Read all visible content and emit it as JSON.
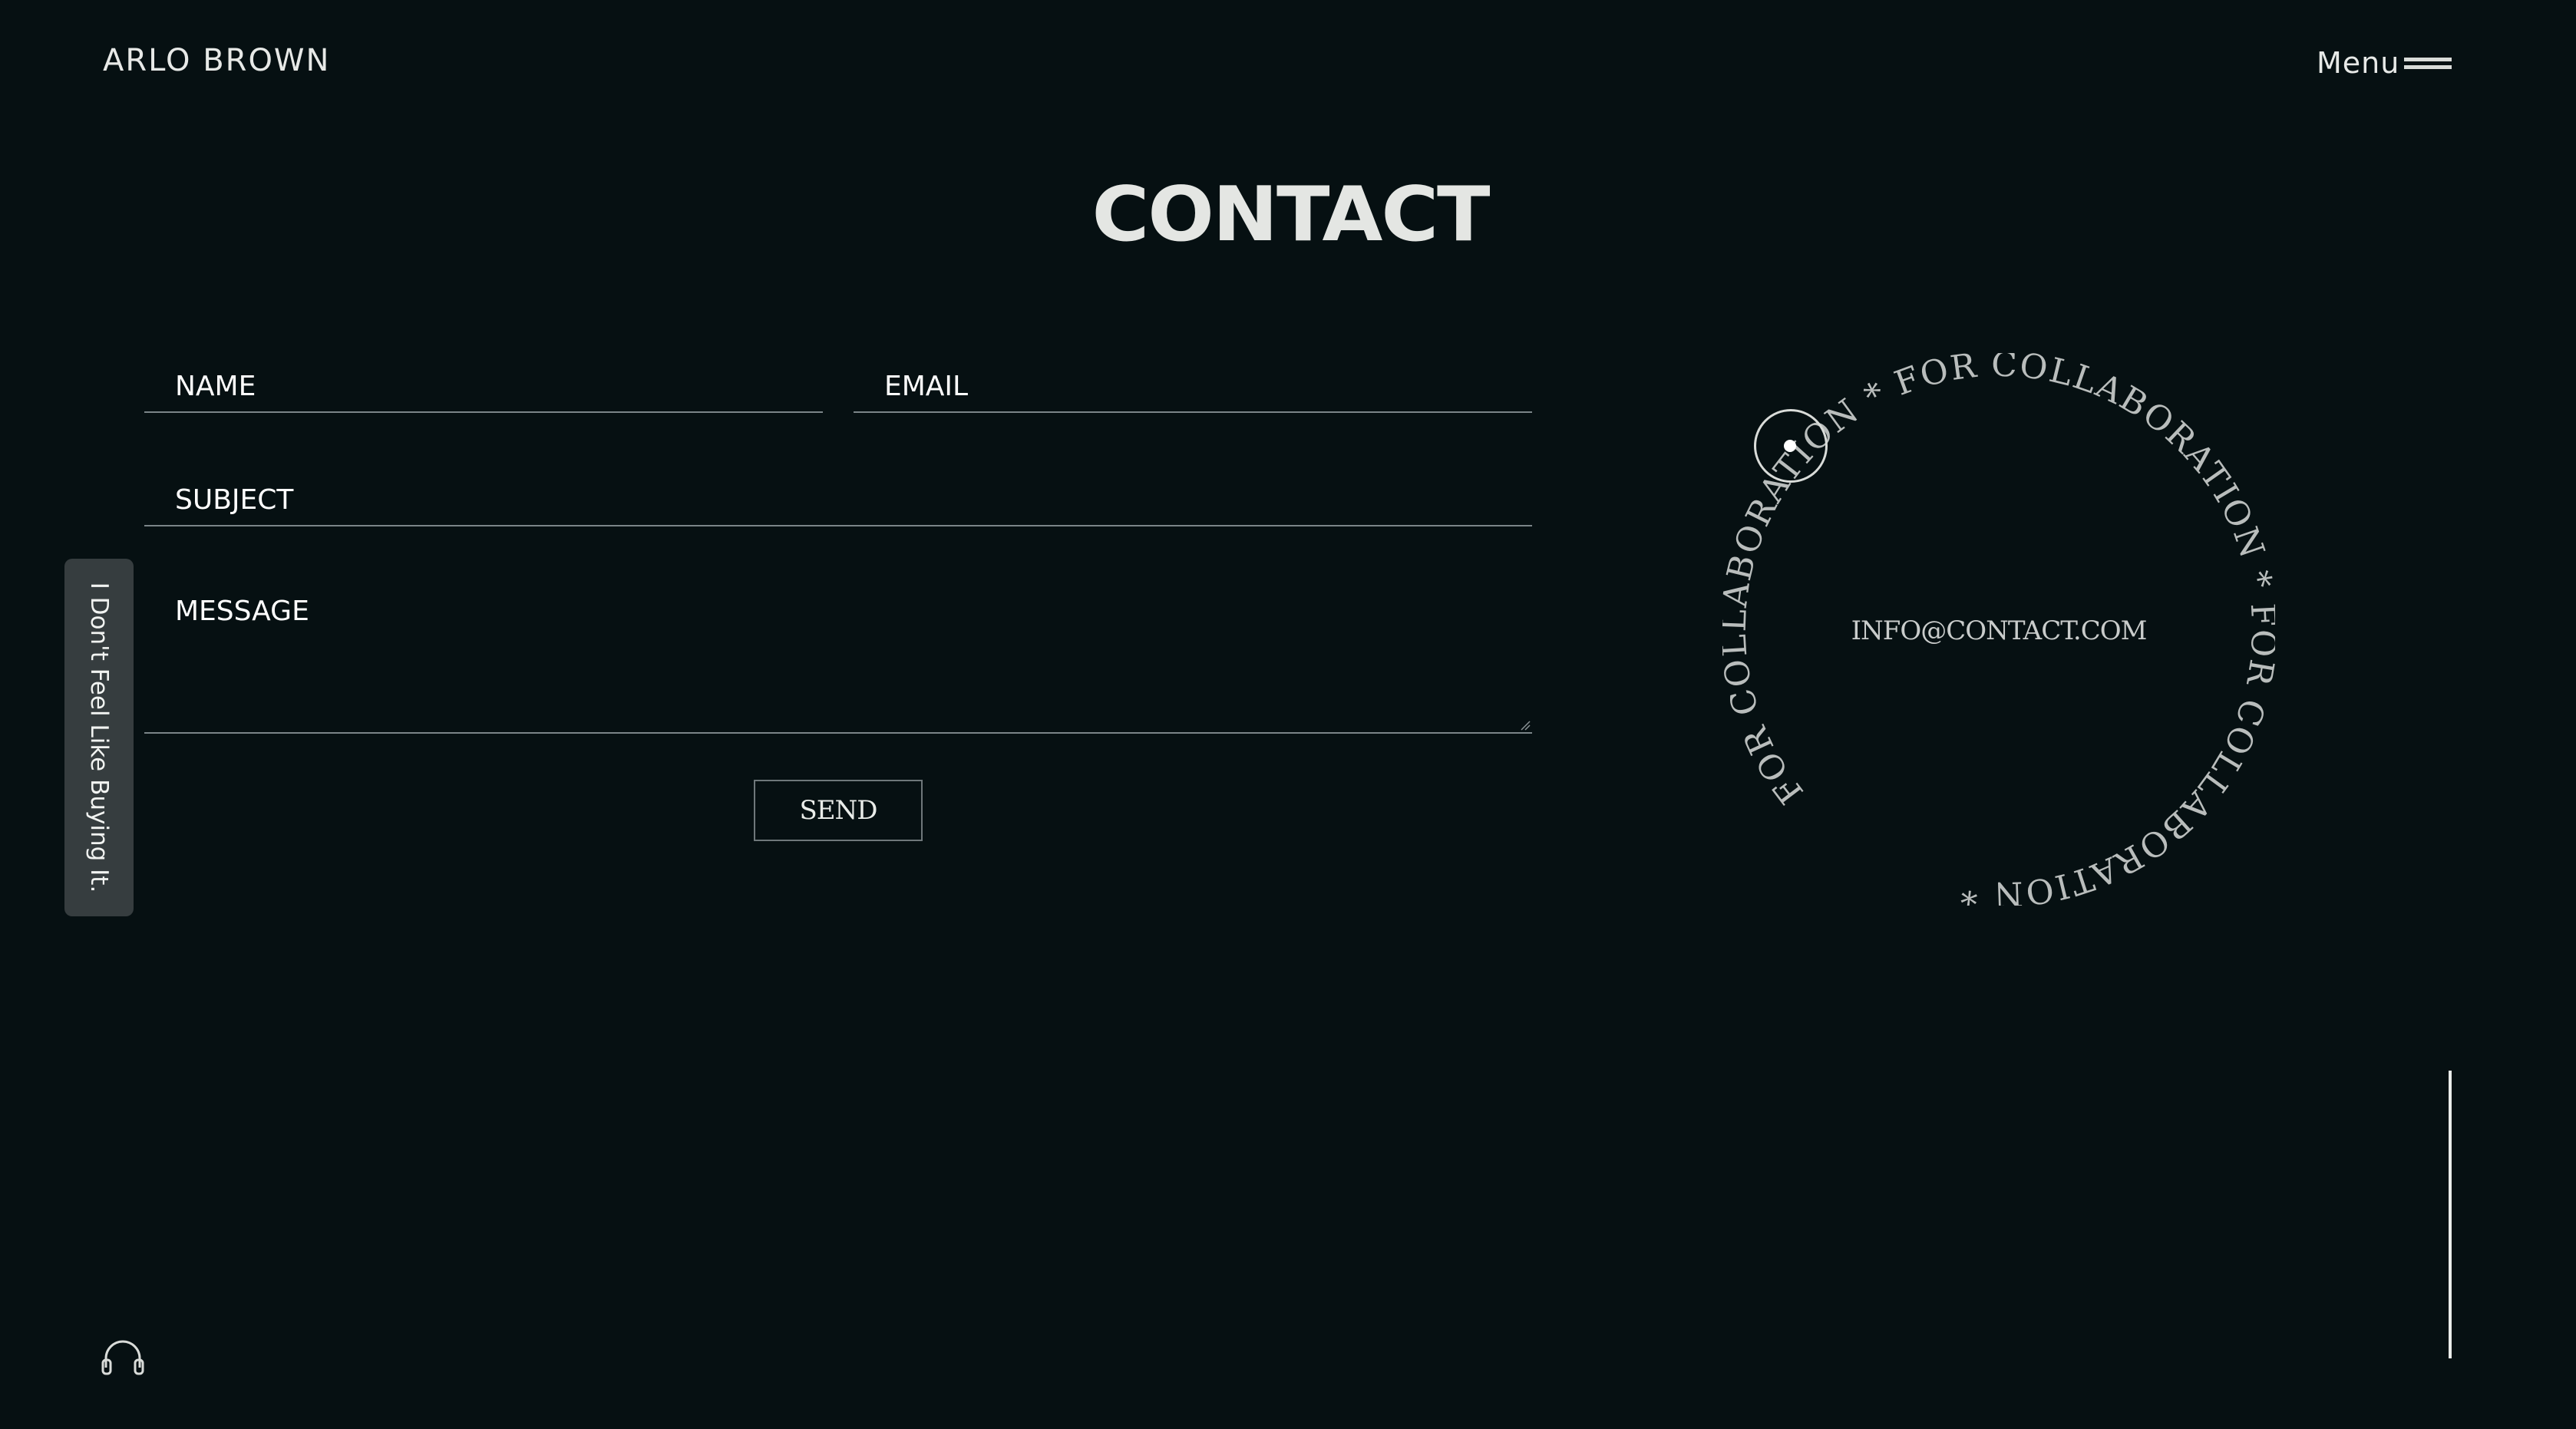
{
  "header": {
    "brand": "ARLO BROWN",
    "menu_label": "Menu",
    "menu_icon": "hamburger-icon"
  },
  "page": {
    "title": "CONTACT"
  },
  "form": {
    "name_placeholder": "NAME",
    "email_placeholder": "EMAIL",
    "subject_placeholder": "SUBJECT",
    "message_placeholder": "MESSAGE",
    "send_label": "SEND"
  },
  "side_tab": {
    "label": "I Don't Feel Like Buying It."
  },
  "badge": {
    "ring_text": "FOR COLLABORATION * FOR COLLABORATION * FOR COLLABORATION * ",
    "email": "INFO@CONTACT.COM"
  },
  "footer": {
    "audio_icon": "headphones-icon"
  },
  "colors": {
    "background": "#061012",
    "text": "#e9ece9",
    "field_underline": "#7b8588",
    "side_tab": "#363d3f",
    "badge_text": "#c9cccb"
  }
}
